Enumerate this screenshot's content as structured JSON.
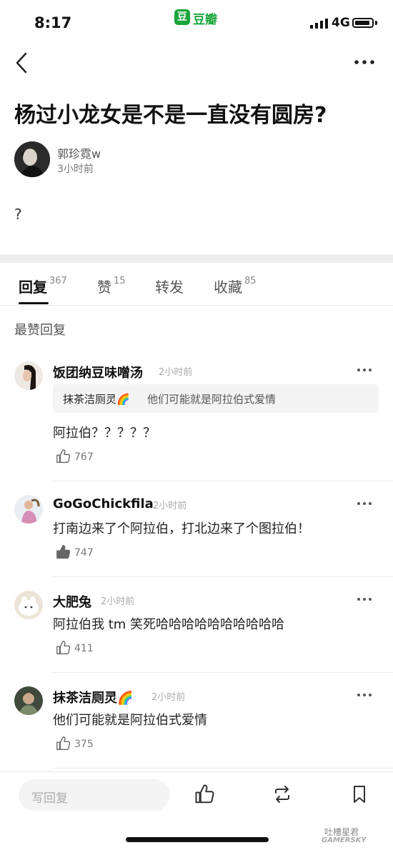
{
  "status_bar": {
    "time": "8:17",
    "app_icon_text": "豆",
    "app_name": "豆瓣",
    "network": "4G"
  },
  "post": {
    "title": "杨过小龙女是不是一直没有圆房?",
    "author": "郭珍霓w",
    "time": "3小时前",
    "body": "?"
  },
  "tabs": [
    {
      "label": "回复",
      "count": "367"
    },
    {
      "label": "赞",
      "count": "15"
    },
    {
      "label": "转发",
      "count": ""
    },
    {
      "label": "收藏",
      "count": "85"
    }
  ],
  "section_label": "最赞回复",
  "comments": [
    {
      "name": "饭团纳豆味噌汤",
      "time": "2小时前",
      "quote": {
        "name": "抹茶洁厕灵🌈",
        "text": "他们可能就是阿拉伯式爱情"
      },
      "text": "阿拉伯？？？？？",
      "likes": "767",
      "liked": false
    },
    {
      "name": "GoGoChickfila",
      "time": "2小时前",
      "text": "打南边来了个阿拉伯，打北边来了个图拉伯！",
      "likes": "747",
      "liked": true
    },
    {
      "name": "大肥兔",
      "time": "2小时前",
      "text": "阿拉伯我 tm 笑死哈哈哈哈哈哈哈哈哈哈",
      "likes": "411",
      "liked": false
    },
    {
      "name": "抹茶洁厕灵🌈",
      "time": "2小时前",
      "text": "他们可能就是阿拉伯式爱情",
      "likes": "375",
      "liked": false
    }
  ],
  "bottom_bar": {
    "reply_placeholder": "写回复"
  },
  "watermark": {
    "line1": "吐槽星君",
    "line2": "GAMERSKY"
  },
  "icons": {
    "back": "chevron-left-icon",
    "more": "more-dots-icon",
    "like": "thumbs-up-icon",
    "repost": "repost-icon",
    "bookmark": "bookmark-icon"
  },
  "colors": {
    "brand": "#1aa53b",
    "text": "#222222",
    "muted": "#888888"
  }
}
